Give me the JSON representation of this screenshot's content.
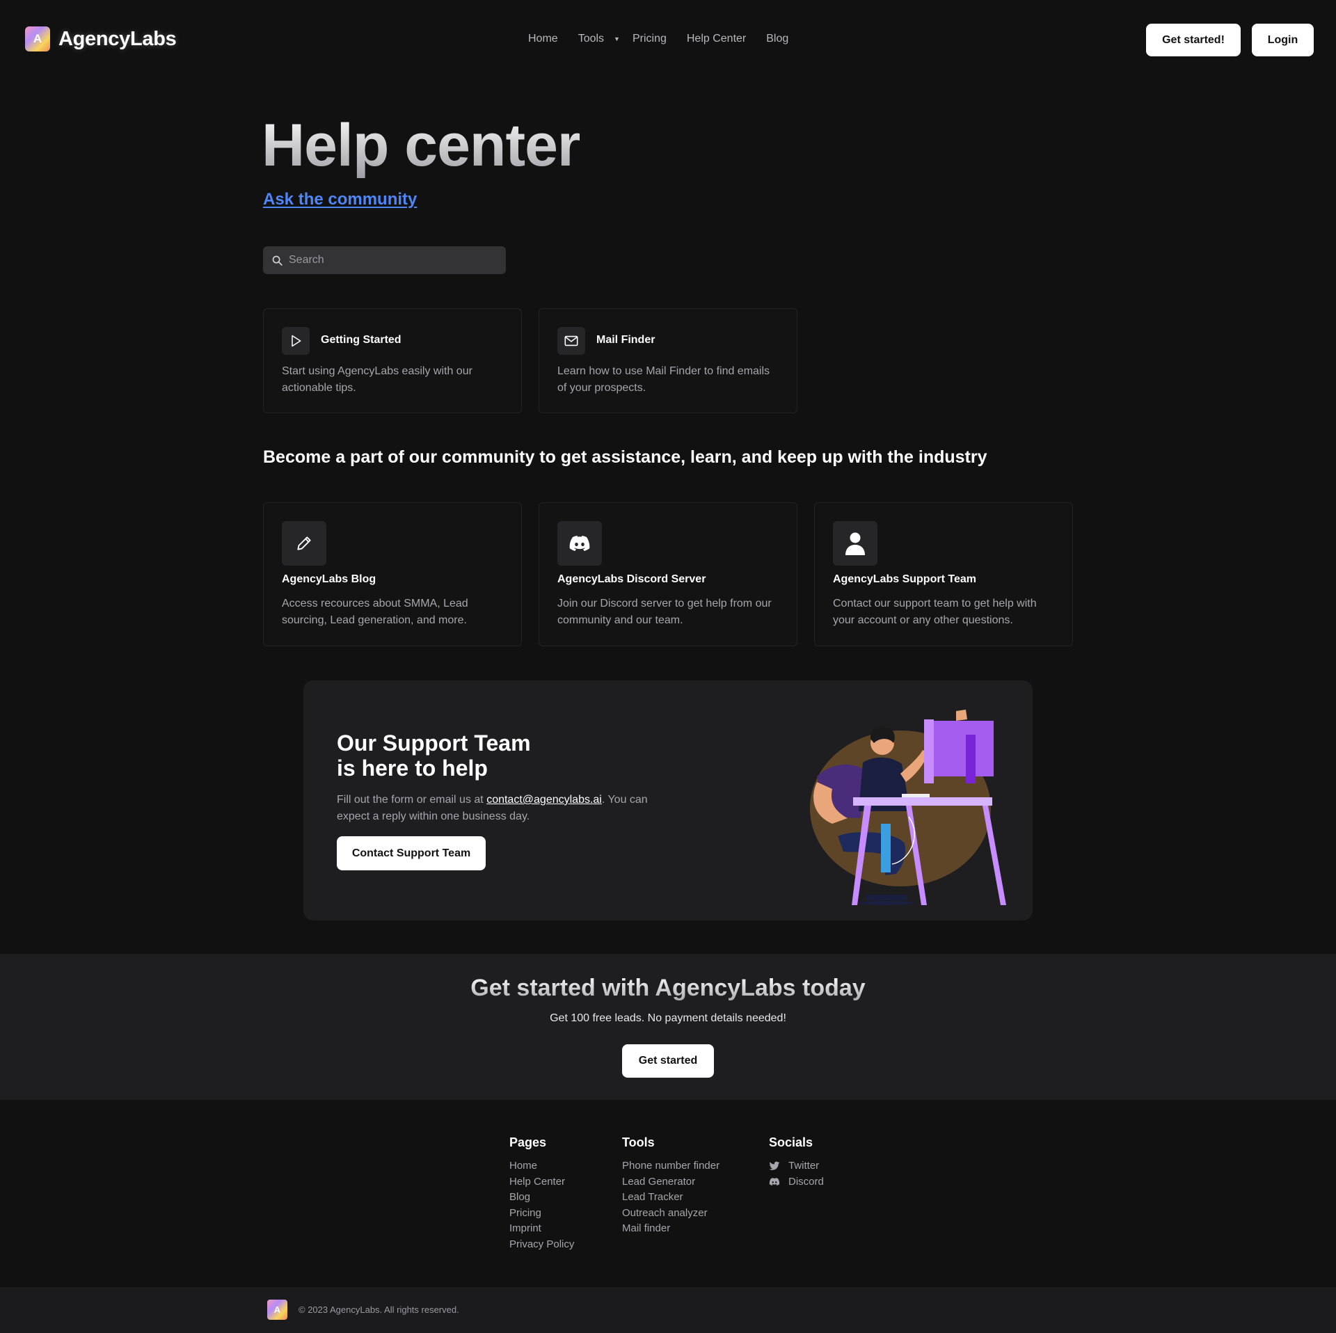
{
  "brand": {
    "name": "AgencyLabs",
    "logo_letter": "A"
  },
  "nav": {
    "links": [
      "Home",
      "Tools",
      "Pricing",
      "Help Center",
      "Blog"
    ],
    "get_started": "Get started!",
    "login": "Login"
  },
  "hero": {
    "title": "Help center",
    "ask_link": "Ask the community",
    "search_placeholder": "Search"
  },
  "top_cards": [
    {
      "title": "Getting Started",
      "desc": "Start using AgencyLabs easily with our actionable tips.",
      "icon": "play-icon"
    },
    {
      "title": "Mail Finder",
      "desc": "Learn how to use Mail Finder to find emails of your prospects.",
      "icon": "mail-icon"
    }
  ],
  "community": {
    "heading": "Become a part of our community to get assistance, learn, and keep up with the industry",
    "cards": [
      {
        "title": "AgencyLabs Blog",
        "desc": "Access recources about SMMA, Lead sourcing, Lead generation, and more.",
        "icon": "pencil-icon"
      },
      {
        "title": "AgencyLabs Discord Server",
        "desc": "Join our Discord server to get help from our community and our team.",
        "icon": "discord-icon"
      },
      {
        "title": "AgencyLabs Support Team",
        "desc": "Contact our support team to get help with your account or any other questions.",
        "icon": "user-icon"
      }
    ]
  },
  "support": {
    "title_line1": "Our Support Team",
    "title_line2": "is here to help",
    "text_before": "Fill out the form or email us at ",
    "email": "contact@agencylabs.ai",
    "text_after": ". You can expect a reply within one business day.",
    "button": "Contact Support Team"
  },
  "cta": {
    "title": "Get started with AgencyLabs today",
    "subtitle": "Get 100 free leads. No payment details needed!",
    "button": "Get started"
  },
  "footer": {
    "pages": {
      "heading": "Pages",
      "links": [
        "Home",
        "Help Center",
        "Blog",
        "Pricing",
        "Imprint",
        "Privacy Policy"
      ]
    },
    "tools": {
      "heading": "Tools",
      "links": [
        "Phone number finder",
        "Lead Generator",
        "Lead Tracker",
        "Outreach analyzer",
        "Mail finder"
      ]
    },
    "socials": {
      "heading": "Socials",
      "links": [
        "Twitter",
        "Discord"
      ]
    },
    "copyright": "© 2023 AgencyLabs. All rights reserved."
  },
  "colors": {
    "background": "#111112",
    "panel": "#1e1e20",
    "accent_link": "#4f86f7",
    "button": "#ffffff"
  }
}
